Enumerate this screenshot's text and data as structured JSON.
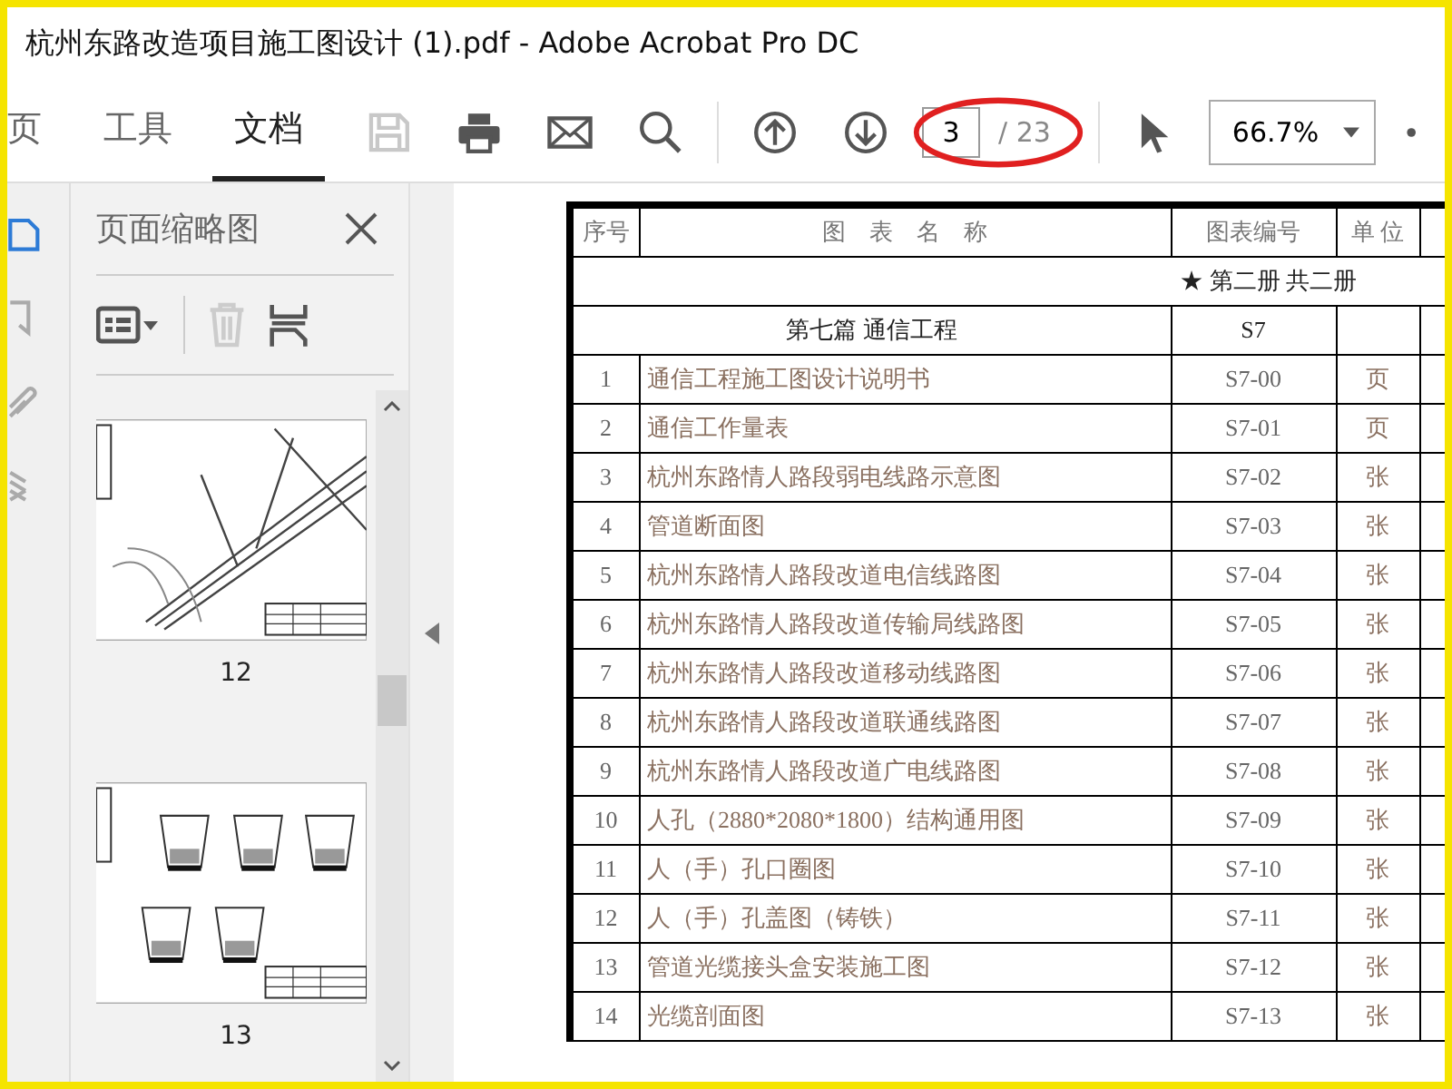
{
  "window": {
    "title": "杭州东路改造项目施工图设计 (1).pdf - Adobe Acrobat Pro DC"
  },
  "toolbar": {
    "tabs": [
      {
        "label": "页",
        "selected": false
      },
      {
        "label": "工具",
        "selected": false
      },
      {
        "label": "文档",
        "selected": true
      }
    ],
    "page_input": {
      "value": "3"
    },
    "page_total": "/ 23",
    "zoom": "66.7%"
  },
  "rail": {
    "items": [
      {
        "kind": "pages",
        "selected": true
      },
      {
        "kind": "bookmark",
        "selected": false
      },
      {
        "kind": "clip",
        "selected": false
      },
      {
        "kind": "layers",
        "selected": false
      }
    ]
  },
  "sidebar": {
    "title": "页面缩略图",
    "thumbnails": [
      {
        "label": "12",
        "kind": "map"
      },
      {
        "label": "13",
        "kind": "sections"
      }
    ]
  },
  "document": {
    "columns": [
      "序号",
      "图　表　名　称",
      "图表编号",
      "单 位"
    ],
    "banner": "★ 第二册 共二册",
    "section": {
      "title": "第七篇  通信工程",
      "code": "S7"
    },
    "rows": [
      {
        "no": "1",
        "name": "通信工程施工图设计说明书",
        "code": "S7-00",
        "unit": "页"
      },
      {
        "no": "2",
        "name": "通信工作量表",
        "code": "S7-01",
        "unit": "页"
      },
      {
        "no": "3",
        "name": "杭州东路情人路段弱电线路示意图",
        "code": "S7-02",
        "unit": "张"
      },
      {
        "no": "4",
        "name": "管道断面图",
        "code": "S7-03",
        "unit": "张"
      },
      {
        "no": "5",
        "name": "杭州东路情人路段改道电信线路图",
        "code": "S7-04",
        "unit": "张"
      },
      {
        "no": "6",
        "name": "杭州东路情人路段改道传输局线路图",
        "code": "S7-05",
        "unit": "张"
      },
      {
        "no": "7",
        "name": "杭州东路情人路段改道移动线路图",
        "code": "S7-06",
        "unit": "张"
      },
      {
        "no": "8",
        "name": "杭州东路情人路段改道联通线路图",
        "code": "S7-07",
        "unit": "张"
      },
      {
        "no": "9",
        "name": "杭州东路情人路段改道广电线路图",
        "code": "S7-08",
        "unit": "张"
      },
      {
        "no": "10",
        "name": "人孔（2880*2080*1800）结构通用图",
        "code": "S7-09",
        "unit": "张"
      },
      {
        "no": "11",
        "name": "人（手）孔口圈图",
        "code": "S7-10",
        "unit": "张"
      },
      {
        "no": "12",
        "name": "人（手）孔盖图（铸铁）",
        "code": "S7-11",
        "unit": "张"
      },
      {
        "no": "13",
        "name": "管道光缆接头盒安装施工图",
        "code": "S7-12",
        "unit": "张"
      },
      {
        "no": "14",
        "name": "光缆剖面图",
        "code": "S7-13",
        "unit": "张"
      }
    ]
  }
}
